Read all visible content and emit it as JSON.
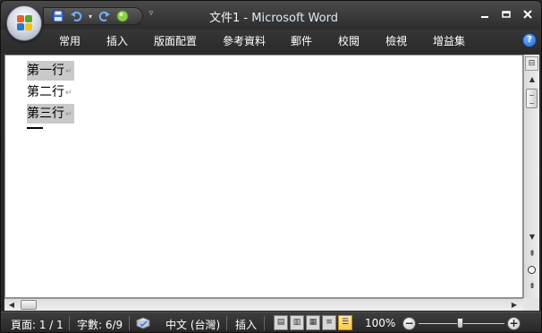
{
  "window": {
    "doc_name": "文件1",
    "separator": " - ",
    "app_name": "Microsoft Word"
  },
  "quick_access": {
    "save_icon": "floppy-save-icon",
    "undo_icon": "undo-icon",
    "redo_icon": "redo-icon",
    "spell_icon": "globe-icon"
  },
  "ribbon": {
    "tabs": [
      "常用",
      "插入",
      "版面配置",
      "參考資料",
      "郵件",
      "校閱",
      "檢視",
      "增益集"
    ]
  },
  "document": {
    "lines": [
      "第一行",
      "第二行",
      "第三行"
    ],
    "paragraph_mark": "↵",
    "selected_lines": [
      0,
      2
    ]
  },
  "statusbar": {
    "page": "頁面: 1 / 1",
    "words": "字數: 6/9",
    "language": "中文 (台灣)",
    "mode": "插入",
    "zoom": "100%"
  },
  "colors": {
    "frame": "#2e2e2e",
    "selection": "#c9c9c9",
    "view_active": "#ffc94d"
  }
}
